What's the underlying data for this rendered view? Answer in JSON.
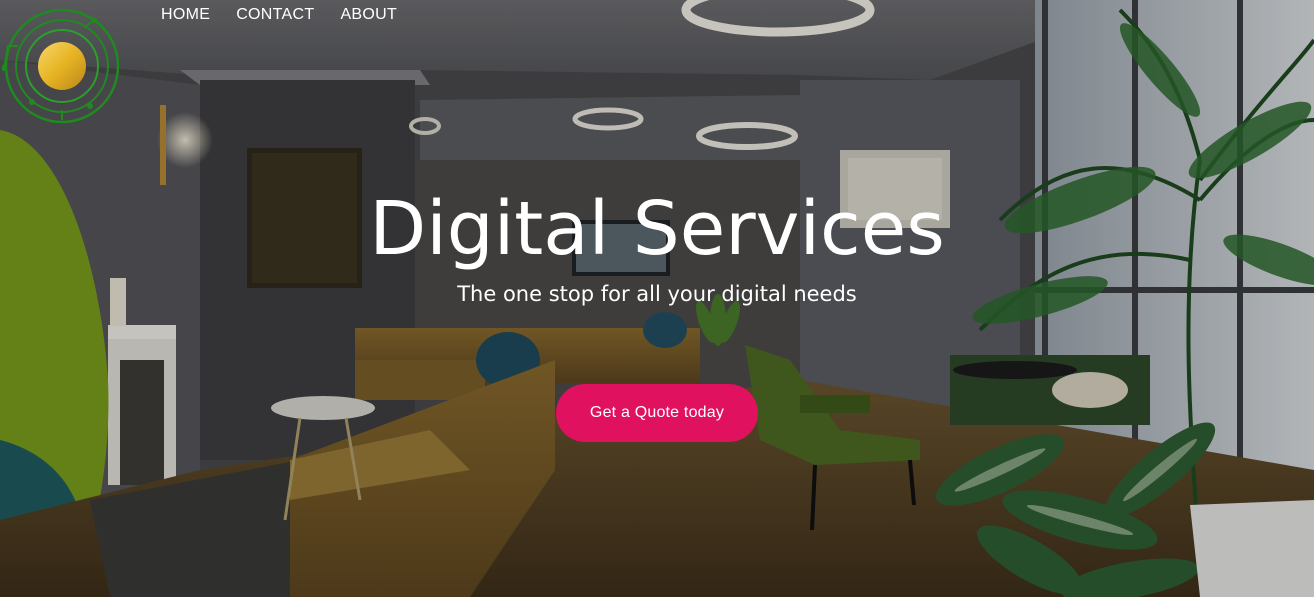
{
  "nav": {
    "items": [
      {
        "label": "HOME"
      },
      {
        "label": "CONTACT"
      },
      {
        "label": "ABOUT"
      }
    ]
  },
  "hero": {
    "title": "Digital Services",
    "subtitle": "The one stop for all your digital needs",
    "cta_label": "Get a Quote today"
  },
  "colors": {
    "accent": "#e0115f",
    "logo_ring": "#1f8a1f",
    "logo_core": "#e6b422",
    "text": "#ffffff"
  },
  "icons": {
    "logo": "circuit-ring-logo"
  }
}
